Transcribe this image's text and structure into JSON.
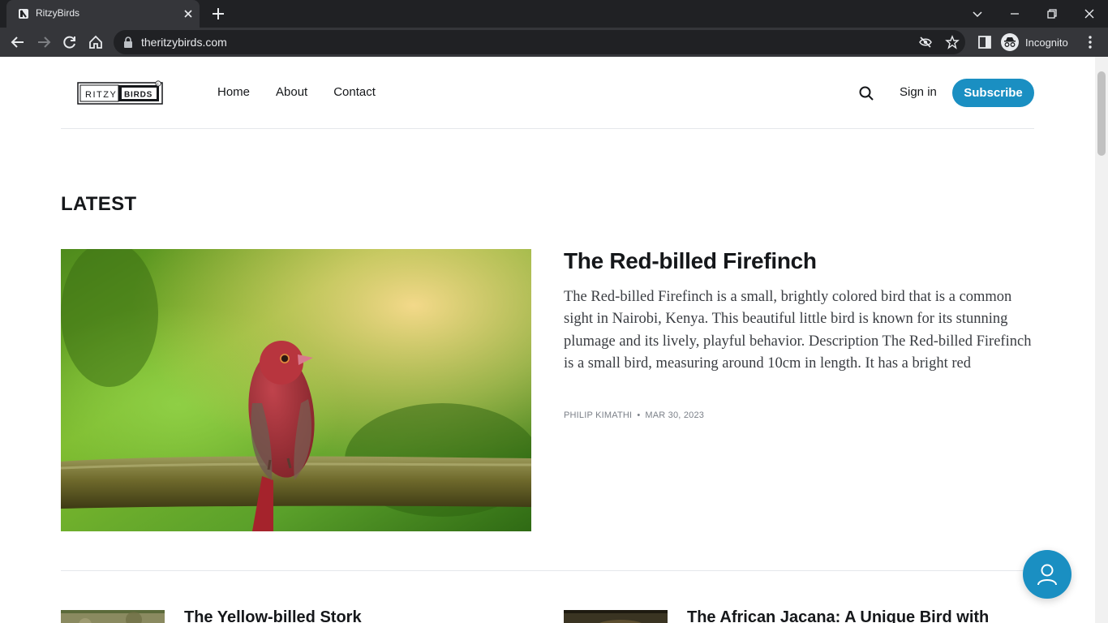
{
  "browser": {
    "tab_title": "RitzyBirds",
    "url": "theritzybirds.com",
    "profile_label": "Incognito"
  },
  "site": {
    "logo_left": "RITZY",
    "logo_right": "BIRDS",
    "nav": [
      "Home",
      "About",
      "Contact"
    ],
    "signin_label": "Sign in",
    "subscribe_label": "Subscribe"
  },
  "main": {
    "section_title": "LATEST",
    "feature": {
      "title": "The Red-billed Firefinch",
      "excerpt": "The Red-billed Firefinch is a small, brightly colored bird that is a common sight in Nairobi, Kenya. This beautiful little bird is known for its stunning plumage and its lively, playful behavior. Description The Red-billed Firefinch is a small bird, measuring around 10cm in length. It has a bright red",
      "author": "PHILIP KIMATHI",
      "separator": "•",
      "date": "MAR 30, 2023"
    },
    "cards": [
      {
        "title": "The Yellow-billed Stork"
      },
      {
        "title": "The African Jacana: A Unique Bird with"
      }
    ]
  },
  "colors": {
    "accent": "#1a8fc2",
    "chrome_dark": "#202124",
    "chrome_mid": "#35363a"
  }
}
